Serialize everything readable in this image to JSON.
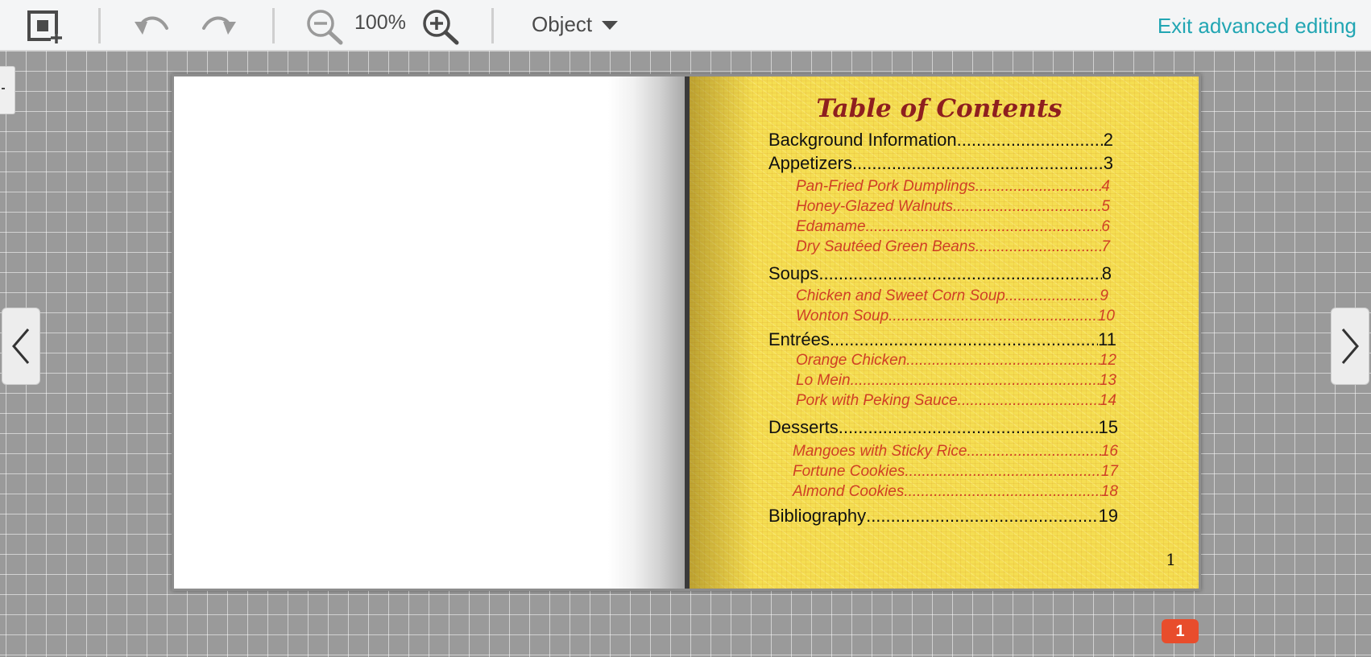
{
  "toolbar": {
    "zoom_level": "100%",
    "mode_label": "Object",
    "exit_label": "Exit advanced editing",
    "icons": [
      "add-frame-icon",
      "undo-icon",
      "redo-icon",
      "zoom-out-icon",
      "zoom-in-icon",
      "chevron-down-icon"
    ]
  },
  "toc": {
    "title": "Table of Contents",
    "page_number": "1",
    "entries": [
      {
        "label": "Background Information",
        "page": "2"
      },
      {
        "label": "Appetizers",
        "page": "3"
      },
      {
        "label": "Pan-Fried Pork Dumplings",
        "page": "4"
      },
      {
        "label": "Honey-Glazed Walnuts",
        "page": "5"
      },
      {
        "label": "Edamame",
        "page": "6"
      },
      {
        "label": "Dry Sautéed Green Beans",
        "page": "7"
      },
      {
        "label": "Soups",
        "page": "8"
      },
      {
        "label": "Chicken and Sweet Corn Soup",
        "page": "9"
      },
      {
        "label": "Wonton Soup",
        "page": "10"
      },
      {
        "label": "Entrées",
        "page": "11"
      },
      {
        "label": "Orange Chicken",
        "page": "12"
      },
      {
        "label": "Lo Mein",
        "page": "13"
      },
      {
        "label": "Pork with Peking Sauce",
        "page": "14"
      },
      {
        "label": "Desserts",
        "page": "15"
      },
      {
        "label": "Mangoes with Sticky Rice",
        "page": "16"
      },
      {
        "label": "Fortune Cookies",
        "page": "17"
      },
      {
        "label": "Almond Cookies",
        "page": "18"
      },
      {
        "label": "Bibliography",
        "page": "19"
      }
    ]
  },
  "badge": {
    "count": "1"
  },
  "colors": {
    "accent": "#22a6b3",
    "toc_title": "#8e1f1f",
    "toc_item": "#cf3f25",
    "page_background": "#f5de52",
    "badge": "#e84d2c"
  }
}
